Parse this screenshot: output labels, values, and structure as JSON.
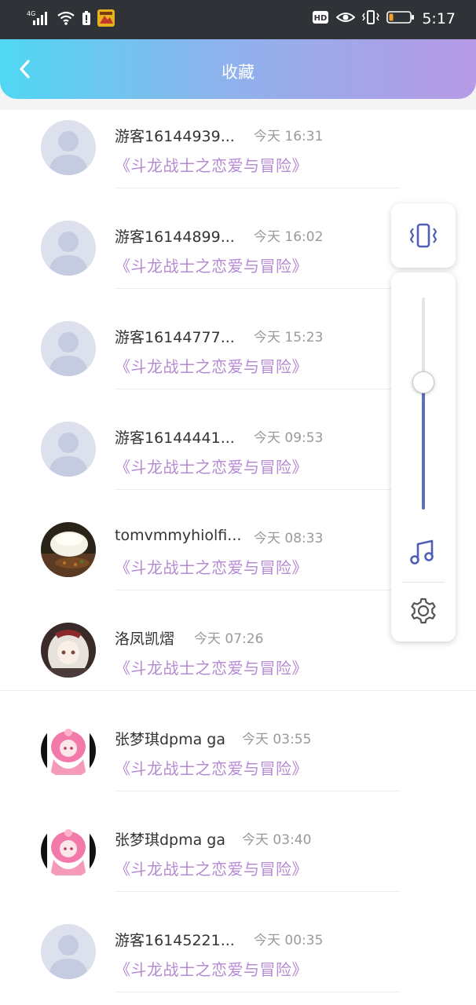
{
  "status_bar": {
    "network": "4G",
    "time": "5:17",
    "hd_label": "HD"
  },
  "header": {
    "title": "收藏"
  },
  "favorites": [
    {
      "name": "游客16144939...",
      "time": "今天 16:31",
      "work": "《斗龙战士之恋爱与冒险》",
      "avatar": "default-avatar"
    },
    {
      "name": "游客16144899...",
      "time": "今天 16:02",
      "work": "《斗龙战士之恋爱与冒险》",
      "avatar": "default-avatar"
    },
    {
      "name": "游客16144777...",
      "time": "今天 15:23",
      "work": "《斗龙战士之恋爱与冒险》",
      "avatar": "default-avatar"
    },
    {
      "name": "游客16144441...",
      "time": "今天 09:53",
      "work": "《斗龙战士之恋爱与冒险》",
      "avatar": "default-avatar"
    },
    {
      "name": "tomvmmyhiolfi...",
      "time": "今天 08:33",
      "work": "《斗龙战士之恋爱与冒险》",
      "avatar": "food-photo"
    },
    {
      "name": "洛凤凯熠",
      "time": "今天 07:26",
      "work": "《斗龙战士之恋爱与冒险》",
      "avatar": "anime-girl"
    },
    {
      "name": "张梦琪dpma ga",
      "time": "今天 03:55",
      "work": "《斗龙战士之恋爱与冒险》",
      "avatar": "pink-anime"
    },
    {
      "name": "张梦琪dpma ga",
      "time": "今天 03:40",
      "work": "《斗龙战士之恋爱与冒险》",
      "avatar": "pink-anime"
    },
    {
      "name": "游客16145221...",
      "time": "今天 00:35",
      "work": "《斗龙战士之恋爱与冒险》",
      "avatar": "default-avatar"
    }
  ],
  "volume_panel": {
    "vibrate_icon": "vibrate-icon",
    "music_icon": "music-note-icon",
    "settings_icon": "gear-icon",
    "volume_level": 0.6
  },
  "colors": {
    "accent": "#5e6fc0",
    "work_title": "#b68ad3",
    "header_start": "#4fd8f3",
    "header_end": "#b79ae6"
  }
}
